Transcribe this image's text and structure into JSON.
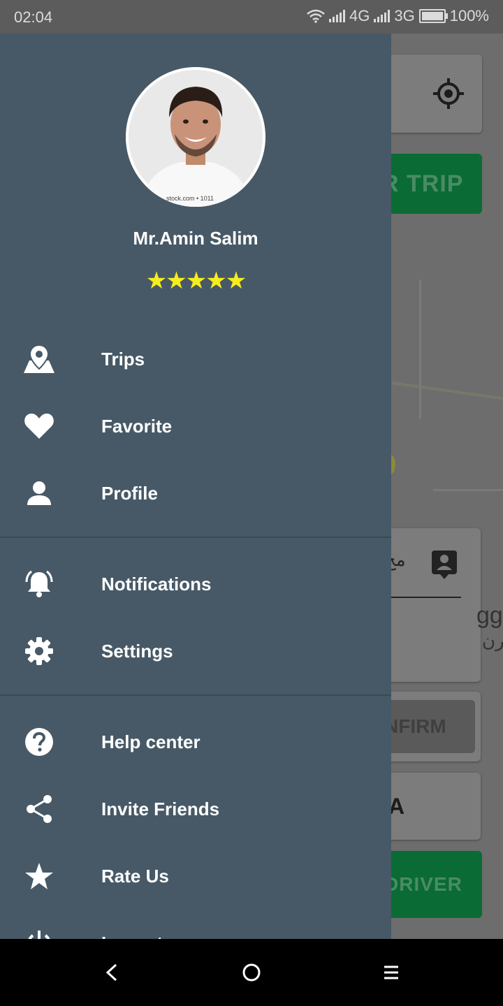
{
  "status_bar": {
    "time": "02:04",
    "network_1": "4G",
    "network_2": "3G",
    "battery_percent": "100%",
    "battery_level": 1.0
  },
  "background": {
    "trip_button_label": "R TRIP",
    "confirm_label": "NFIRM",
    "card_letter": "A",
    "driver_label": "DRIVER",
    "card_text_arabic": "مح",
    "card_text_partial": "gg",
    "card_text_arabic_2": "فرن",
    "accent_green": "#0a6b34"
  },
  "drawer": {
    "user_name": "Mr.Amin Salim",
    "rating_stars": 5,
    "stars_text": "★★★★★",
    "star_color": "#f5ee1c",
    "avatar_watermark": "stock.com • 1011",
    "background_color": "#475966",
    "menu": [
      {
        "label": "Trips",
        "icon": "map-marker-icon"
      },
      {
        "label": "Favorite",
        "icon": "heart-icon"
      },
      {
        "label": "Profile",
        "icon": "person-icon"
      },
      {
        "label": "Notifications",
        "icon": "bell-ringing-icon"
      },
      {
        "label": "Settings",
        "icon": "gear-icon"
      },
      {
        "label": "Help center",
        "icon": "help-circle-icon"
      },
      {
        "label": "Invite Friends",
        "icon": "share-icon"
      },
      {
        "label": "Rate Us",
        "icon": "star-icon"
      },
      {
        "label": "Logout",
        "icon": "power-icon"
      }
    ]
  },
  "nav_bar": {
    "back": "back-icon",
    "home": "home-icon",
    "recents": "menu-icon"
  }
}
